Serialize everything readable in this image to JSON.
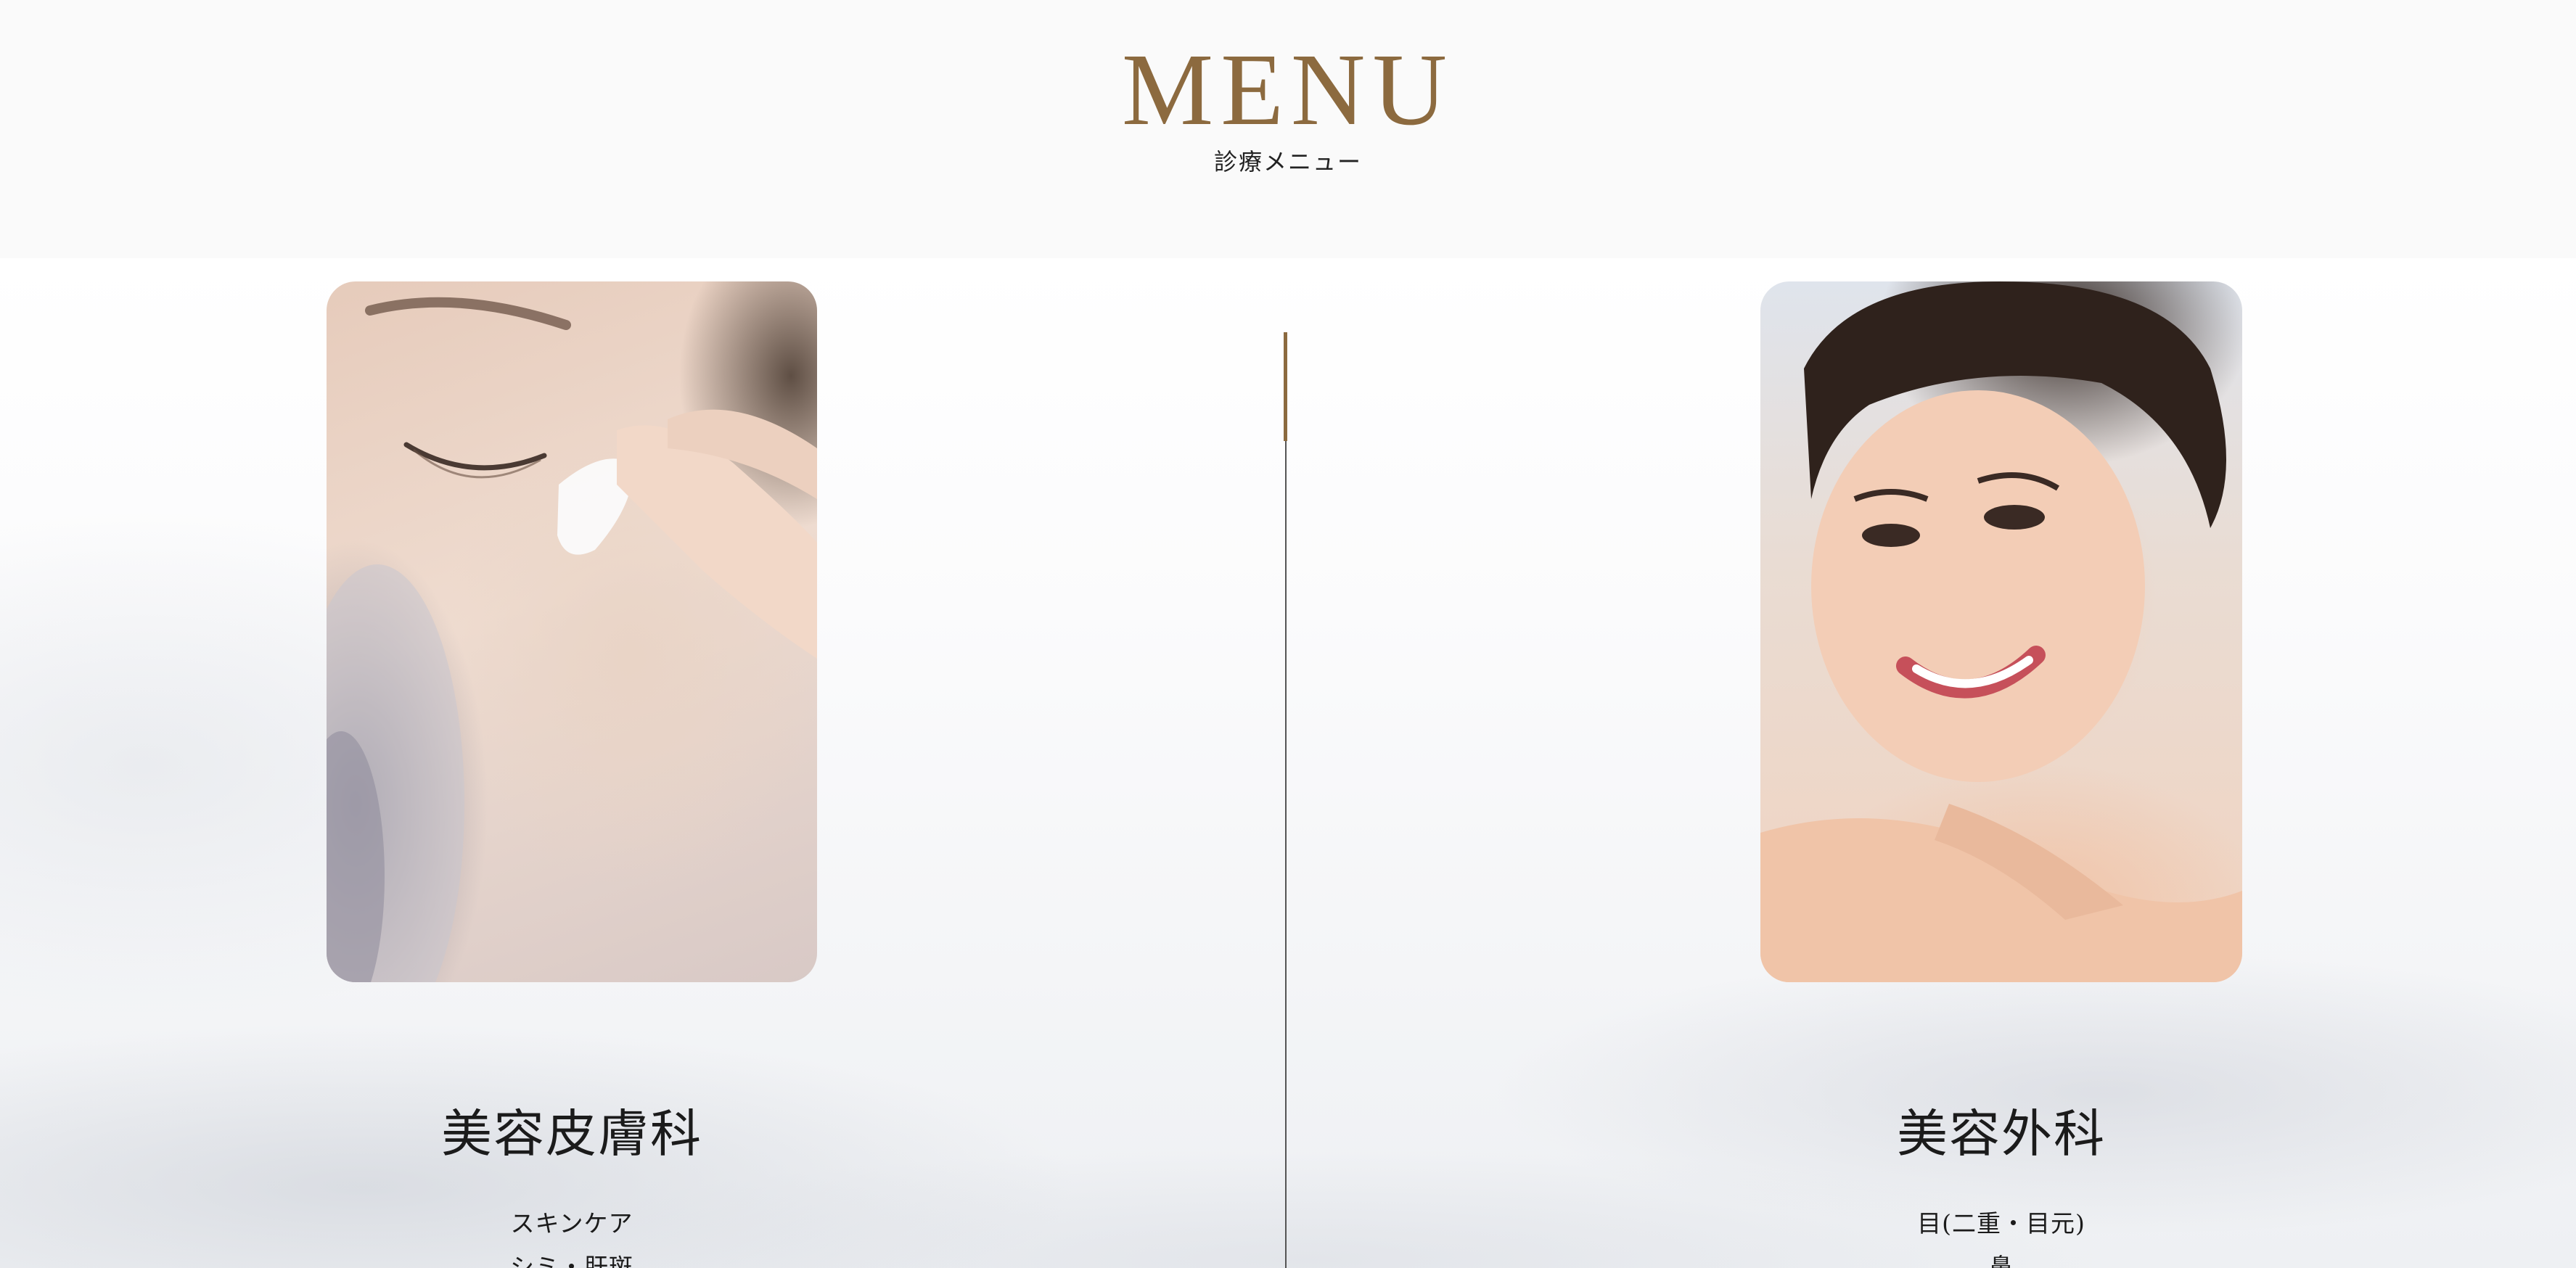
{
  "header": {
    "title": "MENU",
    "subtitle": "診療メニュー"
  },
  "menu": {
    "left": {
      "image_alt": "skincare-woman-photo",
      "title": "美容皮膚科",
      "items": [
        "スキンケア",
        "シミ・肝斑"
      ]
    },
    "right": {
      "image_alt": "smiling-woman-photo",
      "title": "美容外科",
      "items": [
        "目(二重・目元)",
        "鼻"
      ]
    }
  },
  "colors": {
    "accent": "#8c6a3f",
    "divider": "#555555",
    "header_bg": "#fafafa",
    "text": "#1b1b1b"
  }
}
